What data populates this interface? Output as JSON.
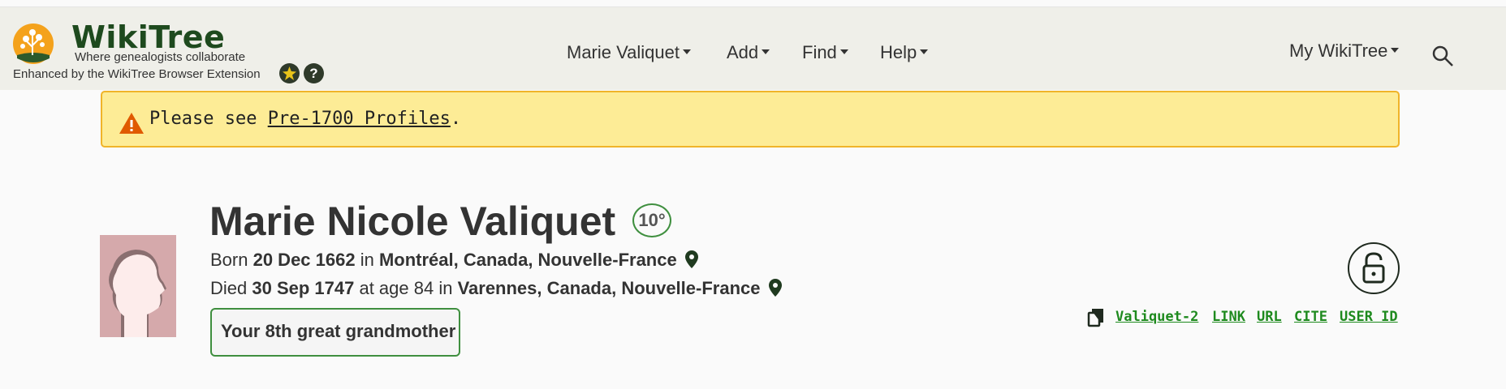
{
  "header": {
    "brand": "WikiTree",
    "tagline": "Where genealogists collaborate",
    "enhanced": "Enhanced by the WikiTree Browser Extension",
    "help_glyph": "?",
    "nav": [
      "Marie Valiquet",
      "Add",
      "Find",
      "Help"
    ],
    "my_wikitree": "My WikiTree",
    "icons": [
      "wikitree-tree-logo",
      "extension-star-icon",
      "help-icon",
      "search-icon"
    ]
  },
  "banner": {
    "prefix": "Please see ",
    "link": "Pre-1700 Profiles",
    "suffix": ".",
    "icon": "warning-icon"
  },
  "profile": {
    "name": "Marie Nicole Valiquet",
    "degree": "10°",
    "born_label": "Born ",
    "born_date": "20 Dec 1662",
    "in_label": " in ",
    "born_place": "Montréal, Canada, Nouvelle-France",
    "died_label": "Died ",
    "died_date": "30 Sep 1747",
    "age_text": " at age 84 in ",
    "died_place": "Varennes, Canada, Nouvelle-France",
    "relationship": "Your 8th great grandmother",
    "wikitree_id": "Valiquet-2",
    "links": [
      "LINK",
      "URL",
      "CITE",
      "USER ID"
    ]
  },
  "colors": {
    "header_bg": "#efefe9",
    "brand_green": "#1e4a1e",
    "banner_bg": "#fdec96",
    "banner_border": "#f0b429",
    "link_green": "#1e8a1e",
    "warning": "#e05a00"
  }
}
